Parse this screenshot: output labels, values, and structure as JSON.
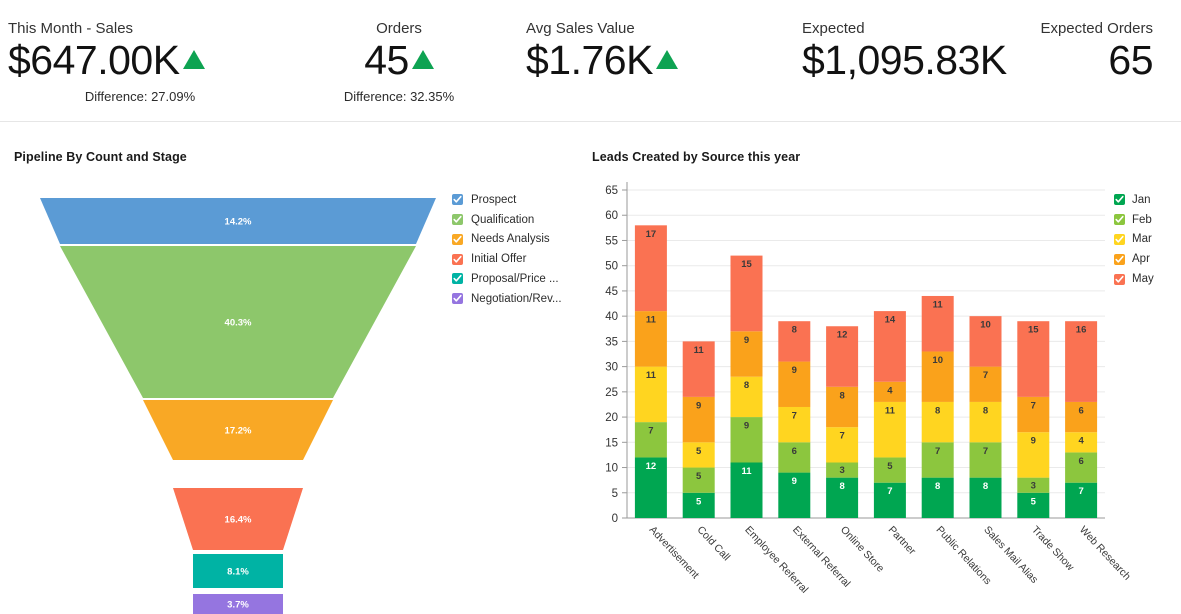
{
  "kpis": [
    {
      "label": "This Month - Sales",
      "value": "$647.00K",
      "trend": "up",
      "difference": "Difference: 27.09%"
    },
    {
      "label": "Orders",
      "value": "45",
      "trend": "up",
      "difference": "Difference: 32.35%"
    },
    {
      "label": "Avg Sales Value",
      "value": "$1.76K",
      "trend": "up",
      "difference": ""
    },
    {
      "label": "Expected",
      "value": "$1,095.83K",
      "trend": "none",
      "difference": ""
    },
    {
      "label": "Expected Orders",
      "value": "65",
      "trend": "none",
      "difference": ""
    }
  ],
  "funnel": {
    "title": "Pipeline By Count and Stage",
    "legend_icon": "checkbox-check-icon",
    "stages": [
      {
        "label": "Prospect",
        "percent": "14.2%",
        "value": 14.2,
        "color": "#5B9BD5"
      },
      {
        "label": "Qualification",
        "percent": "40.3%",
        "value": 40.3,
        "color": "#8DC76B"
      },
      {
        "label": "Needs Analysis",
        "percent": "17.2%",
        "value": 17.2,
        "color": "#F9A825"
      },
      {
        "label": "Initial Offer",
        "percent": "16.4%",
        "value": 16.4,
        "color": "#FA7252"
      },
      {
        "label": "Proposal/Price ...",
        "percent": "8.1%",
        "value": 8.1,
        "color": "#00B3A4"
      },
      {
        "label": "Negotiation/Rev...",
        "percent": "3.7%",
        "value": 3.7,
        "color": "#9575E0"
      }
    ]
  },
  "bars": {
    "title": "Leads Created by Source this year",
    "legend_icon": "checkbox-check-icon"
  },
  "chart_data": [
    {
      "type": "funnel",
      "title": "Pipeline By Count and Stage",
      "categories": [
        "Prospect",
        "Qualification",
        "Needs Analysis",
        "Initial Offer",
        "Proposal/Price ...",
        "Negotiation/Rev..."
      ],
      "values": [
        14.2,
        40.3,
        17.2,
        16.4,
        8.1,
        3.7
      ],
      "value_labels": [
        "14.2%",
        "40.3%",
        "17.2%",
        "16.4%",
        "8.1%",
        "3.7%"
      ],
      "unit": "percent",
      "colors": [
        "#5B9BD5",
        "#8DC76B",
        "#F9A825",
        "#FA7252",
        "#00B3A4",
        "#9575E0"
      ],
      "legend_position": "right",
      "xlabel": "",
      "ylabel": ""
    },
    {
      "type": "bar",
      "subtype": "stacked",
      "title": "Leads Created by Source this year",
      "categories": [
        "Advertisement",
        "Cold Call",
        "Employee Referral",
        "External Referral",
        "Online Store",
        "Partner",
        "Public Relations",
        "Sales Mail Alias",
        "Trade Show",
        "Web Research"
      ],
      "series": [
        {
          "name": "Jan",
          "color": "#00A651",
          "values": [
            12,
            5,
            11,
            9,
            8,
            7,
            8,
            8,
            5,
            7
          ]
        },
        {
          "name": "Feb",
          "color": "#8CC63E",
          "values": [
            7,
            5,
            9,
            6,
            3,
            5,
            7,
            7,
            3,
            6
          ]
        },
        {
          "name": "Mar",
          "color": "#FFD520",
          "values": [
            11,
            5,
            8,
            7,
            7,
            11,
            8,
            8,
            9,
            4
          ]
        },
        {
          "name": "Apr",
          "color": "#FAA21B",
          "values": [
            11,
            9,
            9,
            9,
            8,
            4,
            10,
            7,
            7,
            6
          ]
        },
        {
          "name": "May",
          "color": "#FA7252",
          "values": [
            17,
            11,
            15,
            8,
            12,
            14,
            11,
            10,
            15,
            16
          ]
        }
      ],
      "totals": [
        58,
        35,
        52,
        39,
        38,
        41,
        44,
        40,
        39,
        39
      ],
      "ytick_labels": [
        "0",
        "5",
        "10",
        "15",
        "20",
        "25",
        "30",
        "35",
        "40",
        "45",
        "50",
        "55",
        "60",
        "65"
      ],
      "ylim": [
        0,
        65
      ],
      "ystep": 5,
      "grid": true,
      "legend_position": "right",
      "xlabel": "",
      "ylabel": ""
    }
  ]
}
